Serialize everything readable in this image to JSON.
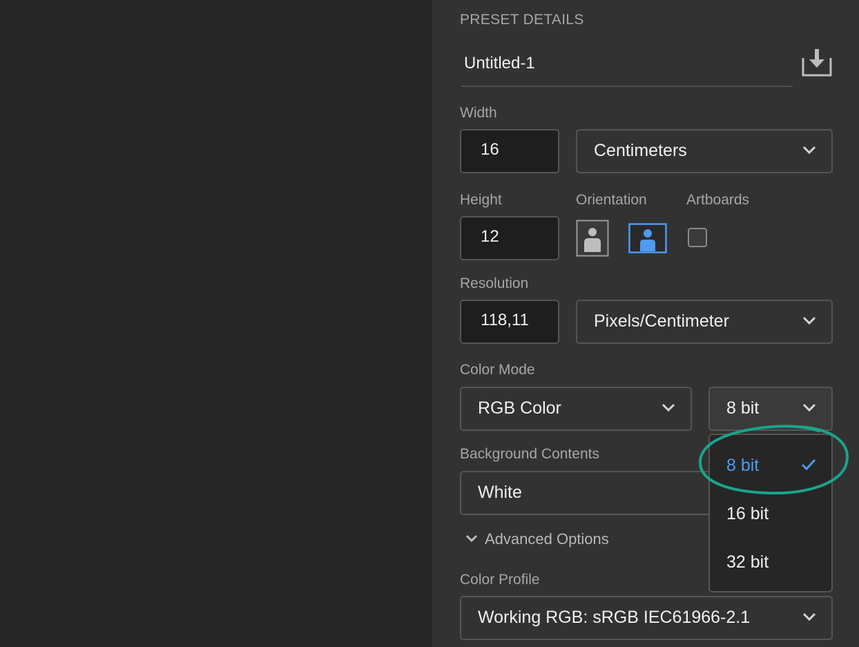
{
  "preset": {
    "section_title": "PRESET DETAILS",
    "name_value": "Untitled-1"
  },
  "width": {
    "label": "Width",
    "value": "16",
    "unit": "Centimeters"
  },
  "height": {
    "label": "Height",
    "value": "12"
  },
  "orientation": {
    "label": "Orientation",
    "selected": "landscape"
  },
  "artboards": {
    "label": "Artboards",
    "checked": false
  },
  "resolution": {
    "label": "Resolution",
    "value": "118,11",
    "unit": "Pixels/Centimeter"
  },
  "color_mode": {
    "label": "Color Mode",
    "mode": "RGB Color",
    "bit_depth": "8 bit"
  },
  "bit_depth_menu": {
    "options": [
      "8 bit",
      "16 bit",
      "32 bit"
    ],
    "selected_index": 0
  },
  "background": {
    "label": "Background Contents",
    "value": "White"
  },
  "advanced": {
    "label": "Advanced Options"
  },
  "color_profile": {
    "label": "Color Profile",
    "value": "Working RGB: sRGB IEC61966-2.1"
  },
  "colors": {
    "panel_bg": "#323232",
    "canvas_bg": "#262626",
    "accent_blue": "#4e9bef",
    "annotation_green": "#1aa38c"
  },
  "icons": {
    "save": "save-preset-icon",
    "portrait": "portrait-orientation-icon",
    "landscape": "landscape-orientation-icon",
    "chevron": "chevron-down-icon",
    "check": "checkmark-icon"
  }
}
